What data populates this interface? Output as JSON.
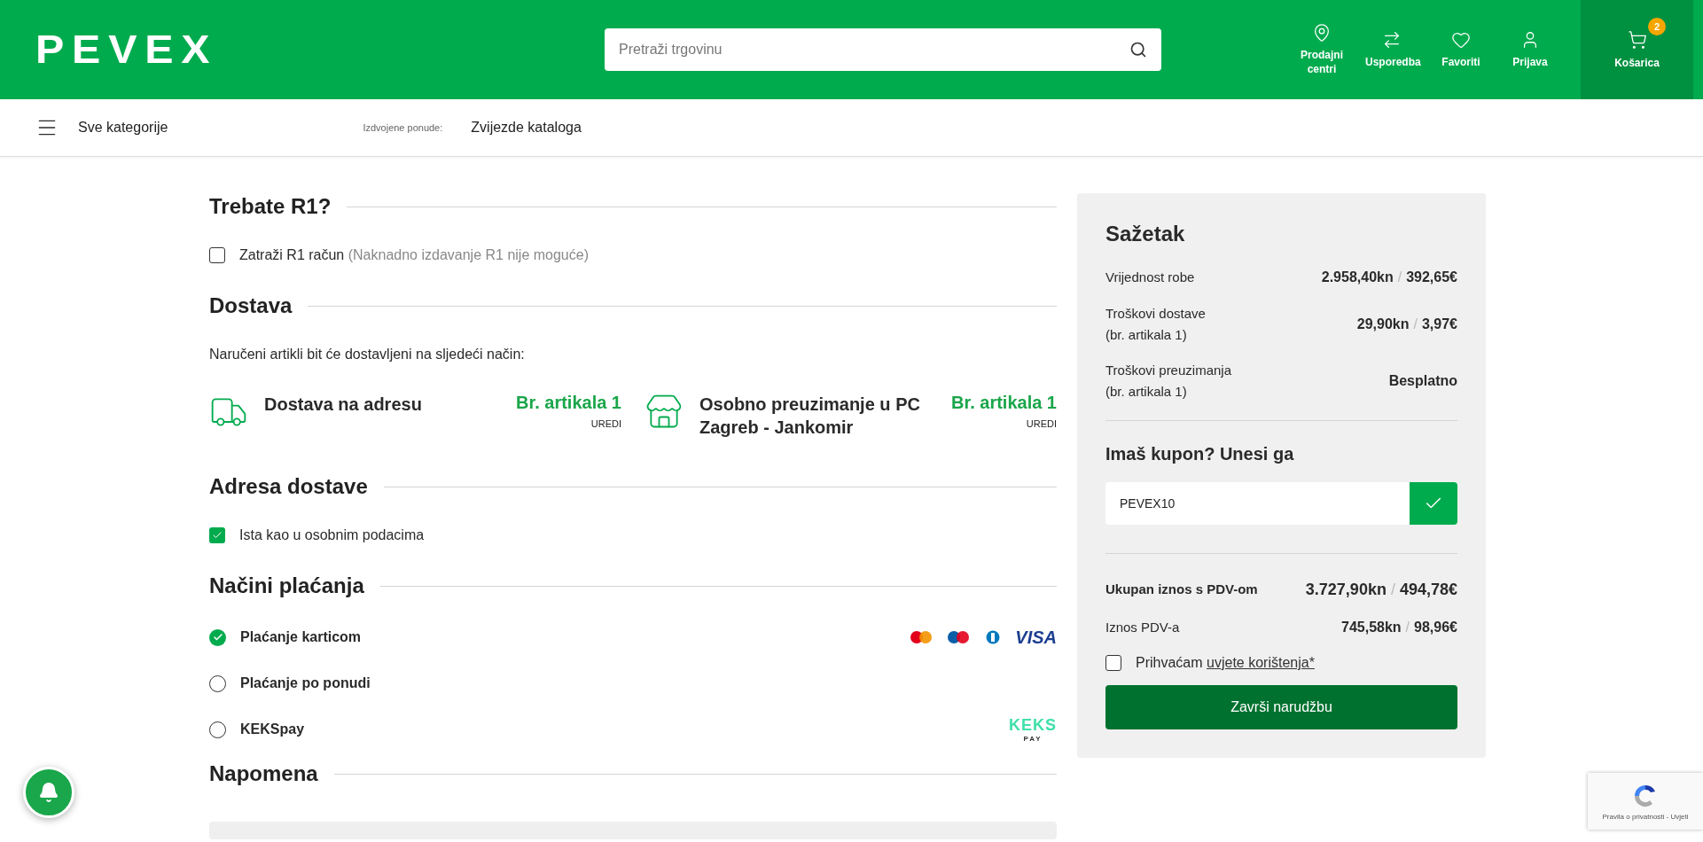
{
  "header": {
    "logo": "PEVEX",
    "search": {
      "placeholder": "Pretraži trgovinu"
    },
    "actions": [
      {
        "label": "Prodajni centri"
      },
      {
        "label": "Usporedba"
      },
      {
        "label": "Favoriti"
      },
      {
        "label": "Prijava"
      }
    ],
    "cart": {
      "label": "Košarica",
      "count": "2"
    }
  },
  "nav": {
    "menu_label": "Sve kategorije",
    "featured_label": "Izdvojene ponude:",
    "featured_link": "Zvijezde kataloga"
  },
  "r1": {
    "title": "Trebate R1?",
    "checkbox": {
      "label": "Zatraži R1 račun",
      "note": "(Naknadno izdavanje R1 nije moguće)",
      "checked": false
    }
  },
  "delivery": {
    "title": "Dostava",
    "intro": "Naručeni artikli bit će dostavljeni na sljedeći način:",
    "options": [
      {
        "kind": "truck",
        "name": "Dostava na adresu",
        "count": "Br. artikala 1",
        "action": "UREDI"
      },
      {
        "kind": "store",
        "name": "Osobno preuzimanje u PC Zagreb - Jankomir",
        "count": "Br. artikala 1",
        "action": "UREDI"
      }
    ]
  },
  "address": {
    "title": "Adresa dostave",
    "checkbox": {
      "label": "Ista kao u osobnim podacima",
      "checked": true
    }
  },
  "payment": {
    "title": "Načini plaćanja",
    "methods": [
      {
        "label": "Plaćanje karticom",
        "selected": true,
        "logo_text": "VISA"
      },
      {
        "label": "Plaćanje po ponudi",
        "selected": false
      },
      {
        "label": "KEKSpay",
        "selected": false,
        "logo_text": "KEKS",
        "logo_subtext": "PAY"
      }
    ]
  },
  "note": {
    "title": "Napomena"
  },
  "summary": {
    "title": "Sažetak",
    "rows": [
      {
        "label": "Vrijednost robe",
        "kn": "2.958,40kn",
        "sep": "/",
        "eur": "392,65€"
      },
      {
        "label": "Troškovi dostave",
        "sub": "(br. artikala 1)",
        "kn": "29,90kn",
        "sep": "/",
        "eur": "3,97€"
      },
      {
        "label": "Troškovi preuzimanja",
        "sub": "(br. artikala 1)",
        "value": "Besplatno"
      }
    ],
    "coupon": {
      "title": "Imaš kupon? Unesi ga",
      "value": "PEVEX10"
    },
    "totals": [
      {
        "label": "Ukupan iznos s PDV-om",
        "kn": "3.727,90kn",
        "sep": "/",
        "eur": "494,78€",
        "bold": true
      },
      {
        "label": "Iznos PDV-a",
        "kn": "745,58kn",
        "sep": "/",
        "eur": "98,96€",
        "bold": false
      }
    ],
    "terms": {
      "text": "Prihvaćam",
      "link": "uvjete korištenja*",
      "checked": false
    },
    "button": "Završi narudžbu"
  },
  "recaptcha": {
    "text": "Pravila o privatnosti - Uvjeti"
  }
}
